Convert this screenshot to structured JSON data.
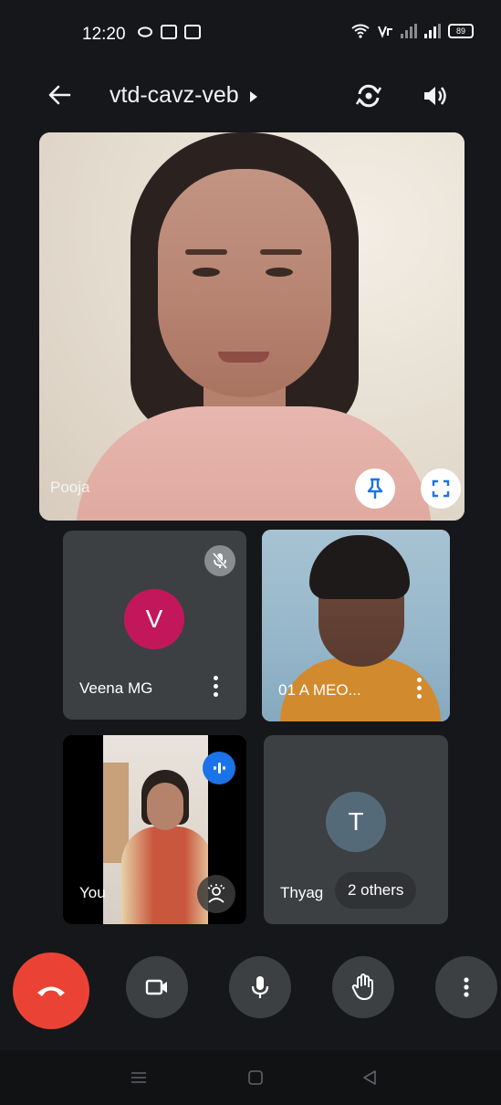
{
  "status_bar": {
    "time": "12:20",
    "battery": "89"
  },
  "app_bar": {
    "meeting_code": "vtd-cavz-veb"
  },
  "main_tile": {
    "participant_name": "Pooja"
  },
  "tiles": [
    {
      "name": "Veena MG",
      "avatar_letter": "V",
      "avatar_color": "#c2185b",
      "muted": true
    },
    {
      "name": "01 A MEO...",
      "active_speaker_highlight": true
    },
    {
      "name": "You",
      "speaking": true
    },
    {
      "name": "Thyag",
      "avatar_letter": "T",
      "avatar_color": "#556a78",
      "others_label": "2 others"
    }
  ],
  "colors": {
    "end_call": "#ea4335",
    "speaking_badge": "#1a73e8",
    "active_border": "#8ab4f8",
    "tile_bg": "#3c4043"
  },
  "icons": {
    "back": "arrow-left-icon",
    "switch_camera": "switch-camera-icon",
    "speaker": "speaker-icon",
    "pin": "pin-icon",
    "fullscreen": "fullscreen-icon",
    "mic_off": "mic-off-icon",
    "more": "more-vert-icon",
    "end_call": "end-call-icon",
    "camera": "video-camera-icon",
    "mic": "mic-icon",
    "raise_hand": "raise-hand-icon",
    "effects": "effects-icon"
  }
}
